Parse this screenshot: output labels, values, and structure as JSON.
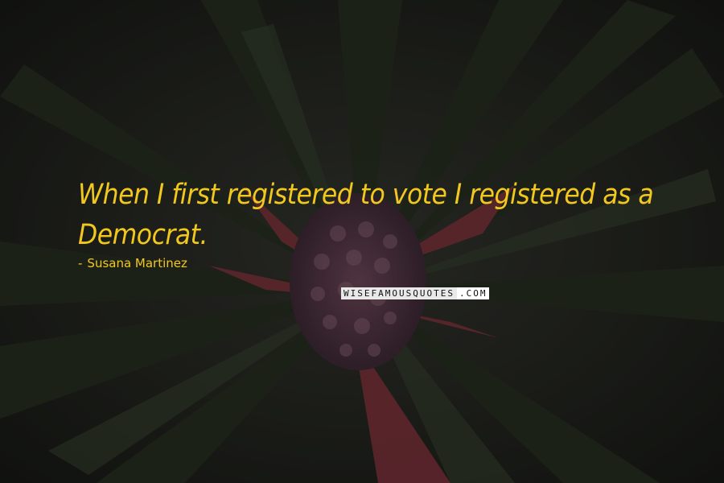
{
  "quote": {
    "text": "When I first registered to vote I registered as a Democrat.",
    "author_dash": "-",
    "author": "Susana Martinez"
  },
  "watermark": {
    "left": "WISEFAMOUSQUOTES",
    "right": ".COM"
  },
  "colors": {
    "quote_text": "#f2c81e",
    "background_dark": "#1e211c",
    "leaf_green": "#2f3a28",
    "leaf_red": "#8b3a40",
    "fruit_purple": "#5a3b4d"
  }
}
